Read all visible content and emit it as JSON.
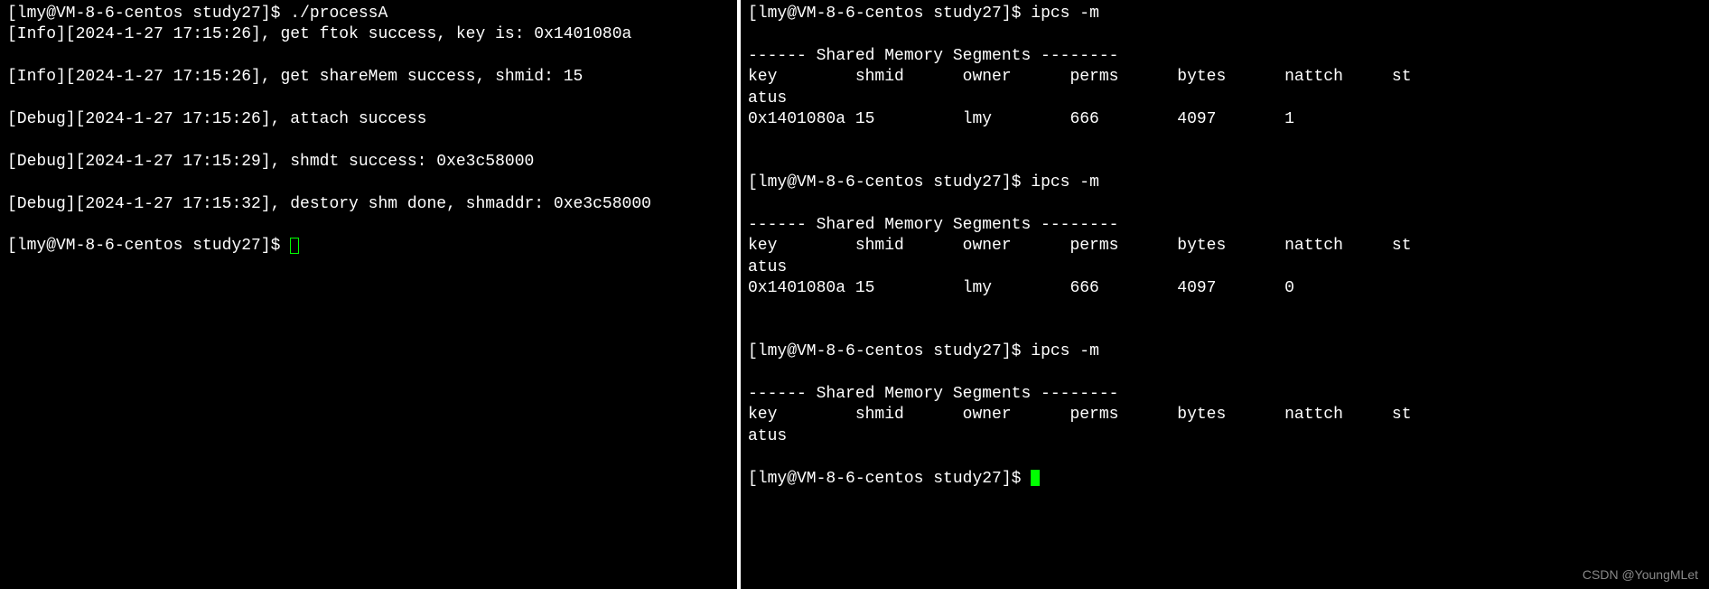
{
  "left": {
    "prompt": "[lmy@VM-8-6-centos study27]$ ",
    "cmd1": "./processA",
    "lines": [
      "[Info][2024-1-27 17:15:26], get ftok success, key is: 0x1401080a",
      "",
      "[Info][2024-1-27 17:15:26], get shareMem success, shmid: 15",
      "",
      "[Debug][2024-1-27 17:15:26], attach success",
      "",
      "[Debug][2024-1-27 17:15:29], shmdt success: 0xe3c58000",
      "",
      "[Debug][2024-1-27 17:15:32], destory shm done, shmaddr: 0xe3c58000",
      ""
    ]
  },
  "right": {
    "prompt": "[lmy@VM-8-6-centos study27]$ ",
    "cmd": "ipcs -m",
    "header_divider": "------ Shared Memory Segments --------",
    "cols": "key        shmid      owner      perms      bytes      nattch     status",
    "cols_wrap1": "key        shmid      owner      perms      bytes      nattch     st",
    "cols_wrap2": "atus",
    "block1_row": "0x1401080a 15         lmy        666        4097       1",
    "block2_row": "0x1401080a 15         lmy        666        4097       0",
    "empty": ""
  },
  "watermark": "CSDN @YoungMLet"
}
